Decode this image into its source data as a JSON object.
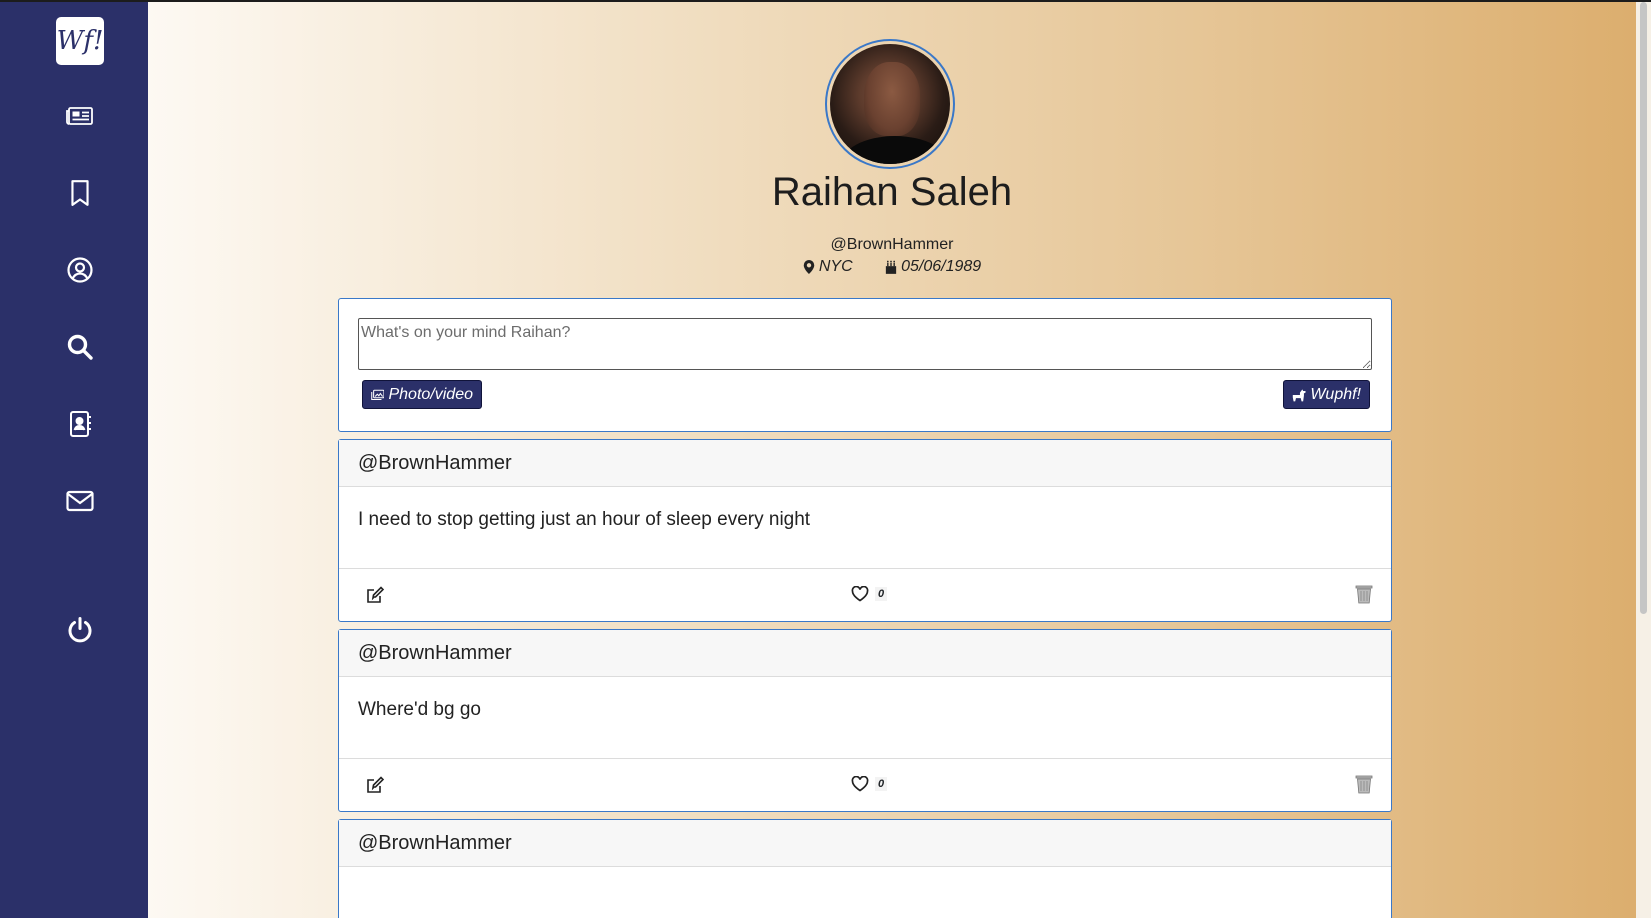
{
  "app": {
    "logo_text": "Wf!"
  },
  "sidebar": {
    "items": [
      {
        "name": "newsfeed",
        "icon": "newspaper-icon"
      },
      {
        "name": "bookmarks",
        "icon": "bookmark-icon"
      },
      {
        "name": "profile",
        "icon": "user-circle-icon"
      },
      {
        "name": "search",
        "icon": "search-icon"
      },
      {
        "name": "contacts",
        "icon": "address-book-icon"
      },
      {
        "name": "messages",
        "icon": "envelope-icon"
      },
      {
        "name": "logout",
        "icon": "power-icon"
      }
    ],
    "bg_color": "#2b3069"
  },
  "profile": {
    "name": "Raihan Saleh",
    "handle": "@BrownHammer",
    "location": "NYC",
    "birthday": "05/06/1989"
  },
  "composer": {
    "placeholder": "What's on your mind Raihan?",
    "photo_label": "Photo/video",
    "submit_label": "Wuphf!"
  },
  "posts": [
    {
      "author": "@BrownHammer",
      "text": "I need to stop getting just an hour of sleep every night",
      "likes": "0"
    },
    {
      "author": "@BrownHammer",
      "text": "Where'd bg go",
      "likes": "0"
    },
    {
      "author": "@BrownHammer",
      "text": "",
      "likes": ""
    }
  ],
  "colors": {
    "accent": "#2b3069",
    "card_border": "#3a78c8"
  }
}
